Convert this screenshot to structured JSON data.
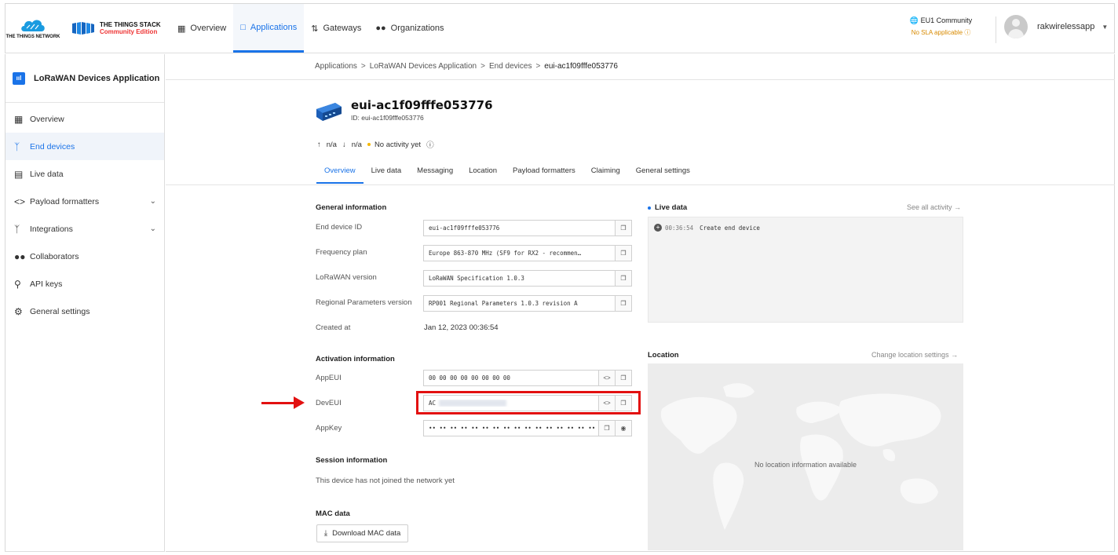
{
  "topbar": {
    "ttn_logo_text": "THE THINGS NETWORK",
    "stack_title": "THE THINGS STACK",
    "stack_subtitle": "Community Edition",
    "nav": [
      {
        "label": "Overview",
        "icon": "grid-icon"
      },
      {
        "label": "Applications",
        "icon": "application-icon",
        "active": true
      },
      {
        "label": "Gateways",
        "icon": "gateway-icon"
      },
      {
        "label": "Organizations",
        "icon": "organization-icon"
      }
    ],
    "cluster": "EU1 Community",
    "sla": "No SLA applicable",
    "username": "rakwirelessapp"
  },
  "sidebar": {
    "app_name": "LoRaWAN Devices Application",
    "items": [
      {
        "label": "Overview",
        "icon": "grid-icon"
      },
      {
        "label": "End devices",
        "icon": "end-devices-icon",
        "active": true
      },
      {
        "label": "Live data",
        "icon": "live-data-icon"
      },
      {
        "label": "Payload formatters",
        "icon": "code-icon",
        "expandable": true
      },
      {
        "label": "Integrations",
        "icon": "integrations-icon",
        "expandable": true
      },
      {
        "label": "Collaborators",
        "icon": "collaborators-icon"
      },
      {
        "label": "API keys",
        "icon": "key-icon"
      },
      {
        "label": "General settings",
        "icon": "gear-icon"
      }
    ]
  },
  "breadcrumb": {
    "items": [
      "Applications",
      "LoRaWAN Devices Application",
      "End devices",
      "eui-ac1f09fffe053776"
    ],
    "separator": ">"
  },
  "device": {
    "name": "eui-ac1f09fffe053776",
    "id_line": "ID: eui-ac1f09fffe053776",
    "uplink": "n/a",
    "downlink": "n/a",
    "activity": "No activity yet"
  },
  "tabs": [
    "Overview",
    "Live data",
    "Messaging",
    "Location",
    "Payload formatters",
    "Claiming",
    "General settings"
  ],
  "general": {
    "title": "General information",
    "end_device_id_label": "End device ID",
    "end_device_id": "eui-ac1f09fffe053776",
    "frequency_plan_label": "Frequency plan",
    "frequency_plan": "Europe 863-870 MHz (SF9 for RX2 - recommen…",
    "lorawan_version_label": "LoRaWAN version",
    "lorawan_version": "LoRaWAN Specification 1.0.3",
    "regional_params_label": "Regional Parameters version",
    "regional_params": "RP001 Regional Parameters 1.0.3 revision A",
    "created_at_label": "Created at",
    "created_at": "Jan 12, 2023 00:36:54"
  },
  "activation": {
    "title": "Activation information",
    "appeui_label": "AppEUI",
    "appeui": "00 00 00 00 00 00 00 00",
    "deveui_label": "DevEUI",
    "deveui_visible": "AC",
    "appkey_label": "AppKey",
    "appkey_masked": "•• •• •• •• •• •• •• •• •• •• •• •• •• •• •• ••"
  },
  "session": {
    "title": "Session information",
    "text": "This device has not joined the network yet"
  },
  "mac": {
    "title": "MAC data",
    "button": "Download MAC data"
  },
  "live": {
    "title": "Live data",
    "see_all": "See all activity →",
    "entry_time": "00:36:54",
    "entry_text": "Create end device"
  },
  "location": {
    "title": "Location",
    "change": "Change location settings →",
    "empty": "No location information available"
  },
  "colors": {
    "accent": "#1a73e8",
    "highlight": "#e21010",
    "sla": "#d88a00"
  }
}
